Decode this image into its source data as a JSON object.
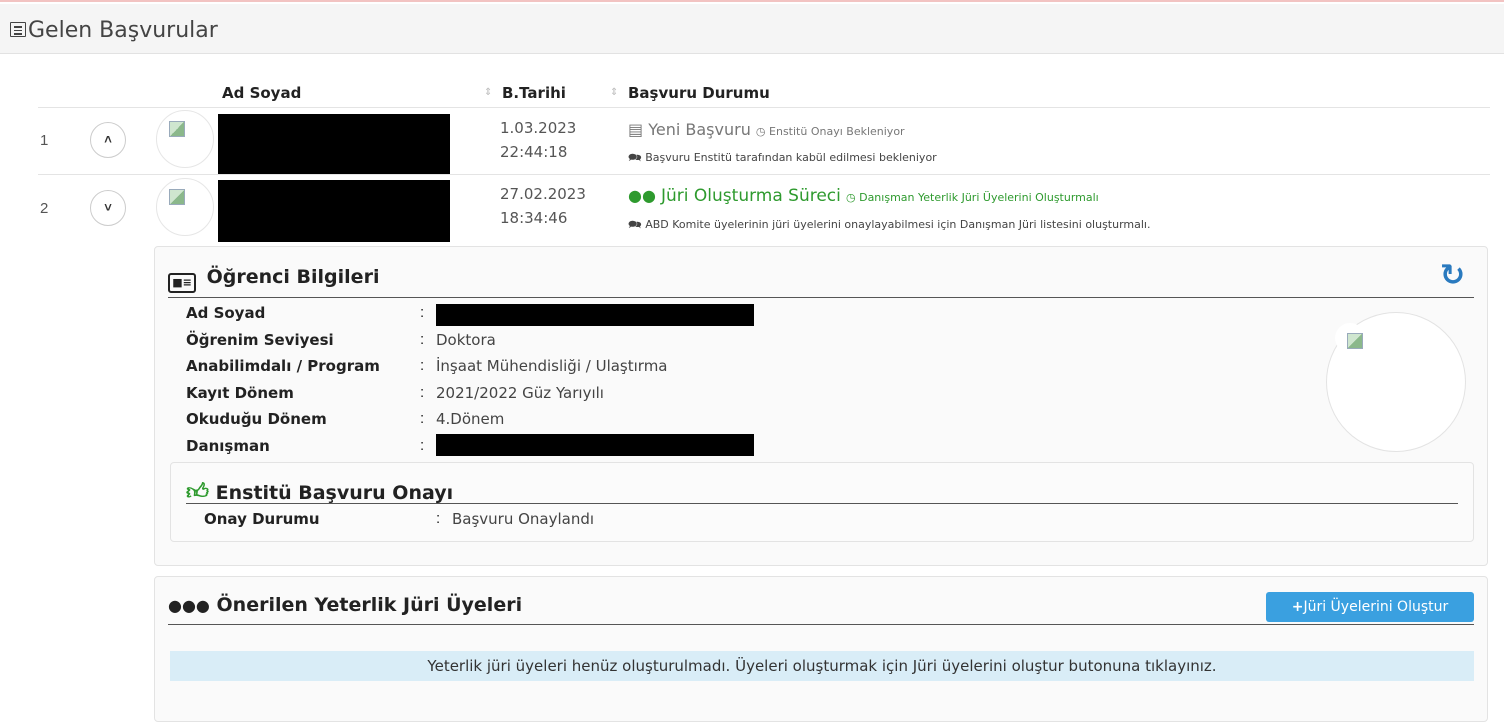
{
  "panel": {
    "title": "Gelen Başvurular",
    "icon": "list-icon"
  },
  "table": {
    "headers": {
      "name": "Ad Soyad",
      "date": "B.Tarihi",
      "status": "Başvuru Durumu"
    },
    "rows": [
      {
        "num": "1",
        "toggle": "˄",
        "date": "1.03.2023",
        "time": "22:44:18",
        "status": "Yeni Başvuru",
        "status_note": "Enstitü Onayı Bekleniyor",
        "detail": "Başvuru Enstitü tarafından kabül edilmesi bekleniyor"
      },
      {
        "num": "2",
        "toggle": "˅",
        "date": "27.02.2023",
        "time": "18:34:46",
        "status": "Jüri Oluşturma Süreci",
        "status_note": "Danışman Yeterlik Jüri Üyelerini Oluşturmalı",
        "detail": "ABD Komite üyelerinin jüri üyelerini onaylayabilmesi için Danışman Jüri listesini oluşturmalı."
      }
    ]
  },
  "student": {
    "title": "Öğrenci Bilgileri",
    "fields": [
      {
        "label": "Ad Soyad",
        "value": ""
      },
      {
        "label": "Öğrenim Seviyesi",
        "value": "Doktora"
      },
      {
        "label": "Anabilimdalı / Program",
        "value": "İnşaat Mühendisliği / Ulaştırma"
      },
      {
        "label": "Kayıt Dönem",
        "value": "2021/2022 Güz Yarıyılı"
      },
      {
        "label": "Okuduğu Dönem",
        "value": "4.Dönem"
      },
      {
        "label": "Danışman",
        "value": ""
      }
    ],
    "approval": {
      "title": "Enstitü Başvuru Onayı",
      "label": "Onay Durumu",
      "value": "Başvuru Onaylandı"
    }
  },
  "jury": {
    "title": "Önerilen Yeterlik Jüri Üyeleri",
    "button": "Jüri Üyelerini Oluştur",
    "info": "Yeterlik jüri üyeleri henüz oluşturulmadı. Üyeleri oluşturmak için Jüri üyelerini oluştur butonuna tıklayınız."
  },
  "colors": {
    "accent": "#3aa0e0",
    "success": "#2e9a2e",
    "info_bg": "#d9edf7"
  }
}
